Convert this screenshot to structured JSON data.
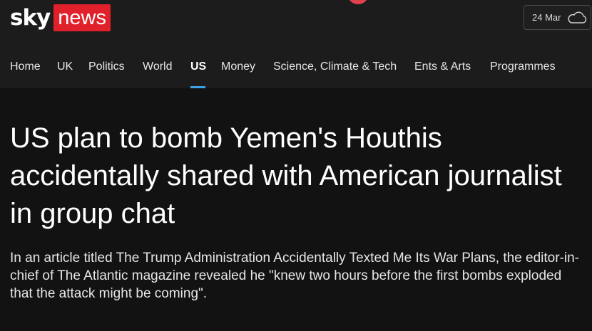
{
  "brand": {
    "sky": "sky",
    "news": "news",
    "red": "#e0212b"
  },
  "weather": {
    "date": "24 Mar",
    "icon": "cloud-icon"
  },
  "nav": {
    "items": [
      {
        "label": "Home"
      },
      {
        "label": "UK"
      },
      {
        "label": "Politics"
      },
      {
        "label": "World"
      },
      {
        "label": "US",
        "active": true
      },
      {
        "label": "Money"
      },
      {
        "label": "Science, Climate & Tech"
      },
      {
        "label": "Ents & Arts"
      },
      {
        "label": "Programmes"
      }
    ],
    "active_color": "#3ea1e8"
  },
  "article": {
    "headline": "US plan to bomb Yemen's Houthis accidentally shared with American journalist in group chat",
    "standfirst": "In an article titled The Trump Administration Accidentally Texted Me Its War Plans, the editor-in-chief of The Atlantic magazine revealed he \"knew two hours before the first bombs exploded that the attack might be coming\"."
  }
}
